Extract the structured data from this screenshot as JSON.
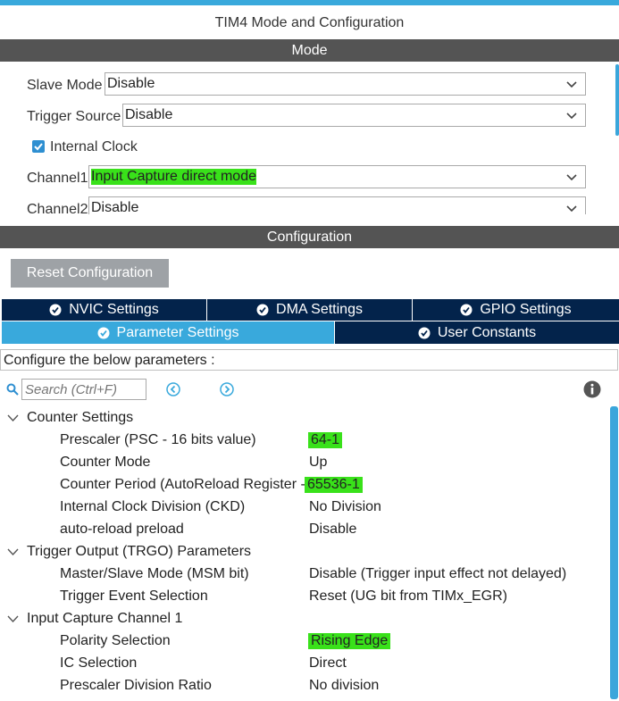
{
  "window": {
    "title": "TIM4 Mode and Configuration"
  },
  "mode_bar": {
    "label": "Mode"
  },
  "mode": {
    "slave_mode": {
      "label": "Slave Mode",
      "value": "Disable"
    },
    "trigger_source": {
      "label": "Trigger Source",
      "value": "Disable"
    },
    "internal_clock": {
      "label": "Internal Clock",
      "checked": true
    },
    "channel1": {
      "label": "Channel1",
      "value": "Input Capture direct mode"
    },
    "channel2": {
      "label": "Channel2",
      "value": "Disable"
    }
  },
  "config_bar": {
    "label": "Configuration"
  },
  "reset_button": {
    "label": "Reset Configuration"
  },
  "tabs_row1": [
    {
      "label": "NVIC Settings"
    },
    {
      "label": "DMA Settings"
    },
    {
      "label": "GPIO Settings"
    }
  ],
  "tabs_row2": [
    {
      "label": "Parameter Settings",
      "active": true
    },
    {
      "label": "User Constants",
      "active": false
    }
  ],
  "config_hint": "Configure the below parameters :",
  "search": {
    "placeholder": "Search (Ctrl+F)"
  },
  "groups": {
    "counter": {
      "title": "Counter Settings",
      "rows": [
        {
          "name": "Prescaler (PSC - 16 bits value)",
          "value": "64-1"
        },
        {
          "name": "Counter Mode",
          "value": "Up"
        },
        {
          "name": "Counter Period (AutoReload Register -",
          "value": "65536-1"
        },
        {
          "name": "Internal Clock Division (CKD)",
          "value": "No Division"
        },
        {
          "name": "auto-reload preload",
          "value": "Disable"
        }
      ]
    },
    "trgo": {
      "title": "Trigger Output (TRGO) Parameters",
      "rows": [
        {
          "name": "Master/Slave Mode (MSM bit)",
          "value": "Disable (Trigger input effect not delayed)"
        },
        {
          "name": "Trigger Event Selection",
          "value": "Reset (UG bit from TIMx_EGR)"
        }
      ]
    },
    "ic1": {
      "title": "Input Capture Channel 1",
      "rows": [
        {
          "name": "Polarity Selection",
          "value": "Rising Edge"
        },
        {
          "name": "IC Selection",
          "value": "Direct"
        },
        {
          "name": "Prescaler Division Ratio",
          "value": "No division"
        }
      ]
    }
  },
  "colors": {
    "accent": "#39a9dc",
    "tab_dark": "#03234b",
    "highlight": "#39e11a",
    "bar": "#545454"
  }
}
